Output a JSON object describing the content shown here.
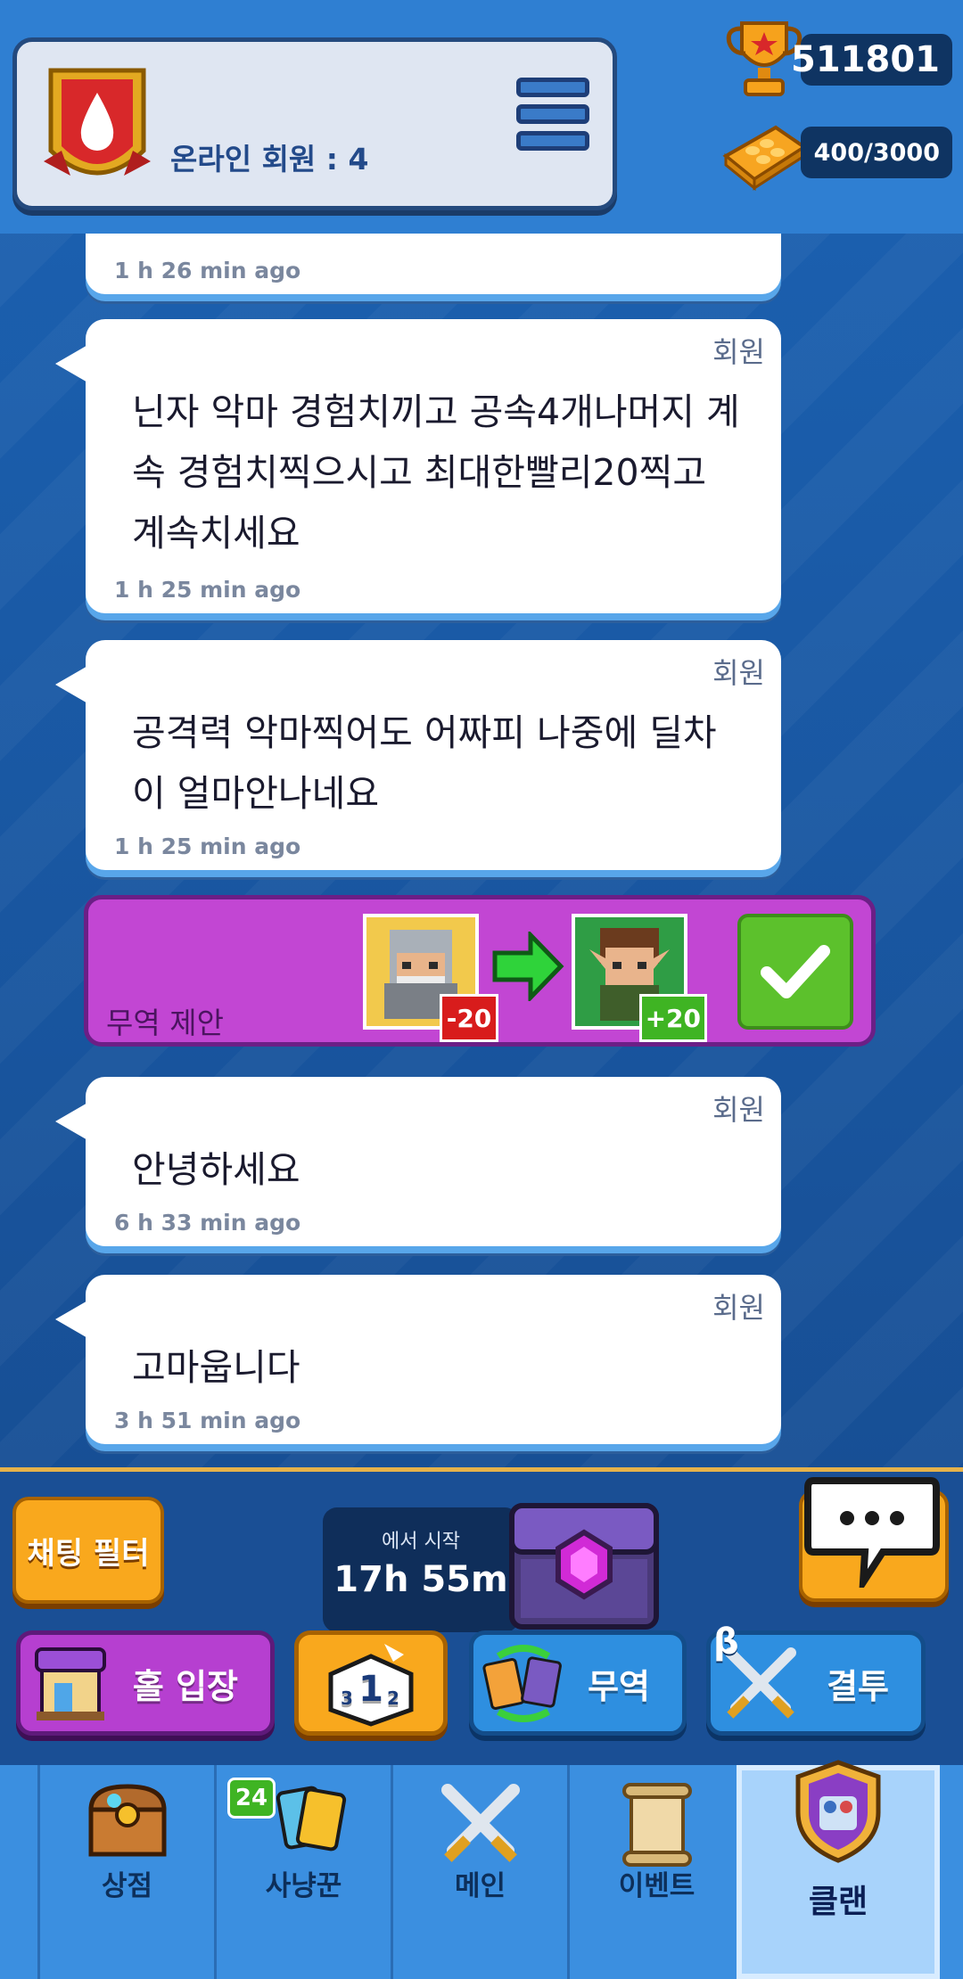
{
  "header": {
    "online_members_label": "온라인 회원 : 4",
    "trophies": "511801",
    "capacity": "400/3000"
  },
  "messages": [
    {
      "author": "",
      "text": "",
      "time": "1 h 26 min ago"
    },
    {
      "author": "회원",
      "text": "닌자 악마 경험치끼고 공속4개나머지 계속 경험치찍으시고 최대한빨리20찍고 계속치세요",
      "time": "1 h 25 min ago"
    },
    {
      "author": "회원",
      "text": "공격력 악마찍어도 어짜피 나중에 딜차이 얼마안나네요",
      "time": "1 h 25 min ago"
    },
    {
      "author": "회원",
      "text": "안녕하세요",
      "time": "6 h 33 min ago"
    },
    {
      "author": "회원",
      "text": "고마웁니다",
      "time": "3 h 51 min ago"
    }
  ],
  "trade_offer": {
    "label": "무역 제안",
    "give_count": "-20",
    "get_count": "+20"
  },
  "actions": {
    "chat_filter": "채팅 필터",
    "timer_label": "에서 시작",
    "timer_value": "17h 55m",
    "hall": "홀 입장",
    "trade": "무역",
    "duel": "결투",
    "beta": "β"
  },
  "nav": [
    {
      "label": "상점"
    },
    {
      "label": "사냥꾼",
      "badge": "24"
    },
    {
      "label": "메인"
    },
    {
      "label": "이벤트"
    },
    {
      "label": "클랜"
    }
  ],
  "colors": {
    "accent_orange": "#f9a81d",
    "trade_purple": "#c246d3",
    "confirm_green": "#5cc12c"
  }
}
